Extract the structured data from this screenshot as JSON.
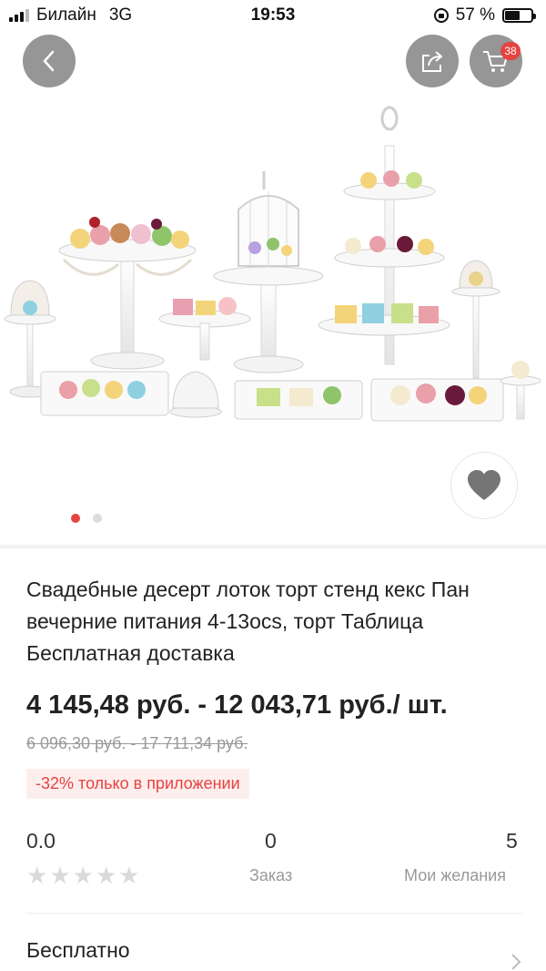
{
  "status_bar": {
    "carrier": "Билайн",
    "network": "3G",
    "time": "19:53",
    "battery": "57 %",
    "battery_level": 0.57
  },
  "header": {
    "back_icon": "chevron-left-icon",
    "share_icon": "share-icon",
    "cart_icon": "cart-icon",
    "cart_count": "38"
  },
  "gallery": {
    "image_alt": "Wedding dessert stands set",
    "pages": 2,
    "active_page": 1,
    "wishlist_icon": "heart-icon"
  },
  "product": {
    "title": "Свадебные десерт лоток торт стенд кекс Пан вечерние питания 4-13ocs, торт Таблица Бесплатная доставка",
    "price": "4 145,48 руб. - 12 043,71 руб./ шт.",
    "old_price": "6 096,30 руб. - 17 711,34 руб.",
    "promo": "-32% только в приложении"
  },
  "stats": {
    "rating": "0.0",
    "stars": 0,
    "orders_value": "0",
    "orders_label": "Заказ",
    "wishlist_value": "5",
    "wishlist_label": "Мои желания"
  },
  "shipping": {
    "label": "Бесплатно"
  },
  "colors": {
    "accent": "#e64340",
    "promo_bg": "#fdeeee",
    "button_bg": "#787878"
  }
}
